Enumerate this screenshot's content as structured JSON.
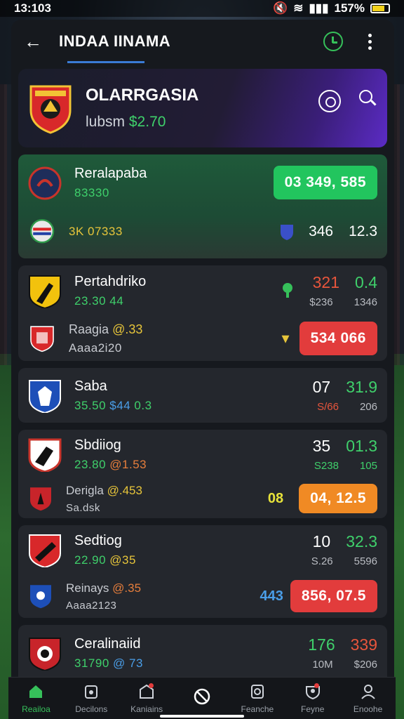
{
  "status_bar": {
    "time": "13:103",
    "battery": "157%"
  },
  "header": {
    "title": "INDAA IINAMA"
  },
  "hero": {
    "team": "OLARRGASIA",
    "label": "lubsm",
    "amount": "$2.70"
  },
  "colors": {
    "green": "#22c55e",
    "red": "#e23c3c",
    "orange": "#f08a24",
    "accent": "#36c05a"
  },
  "featured": {
    "team": "Reralapaba",
    "meta": "83330",
    "pill": "03  349, 585",
    "row2_meta": "3K 07333",
    "row2_nums": [
      "346",
      "12.3"
    ]
  },
  "matches": [
    {
      "team": "Pertahdriko",
      "meta": "23.30 44",
      "big": [
        "321",
        "0.4"
      ],
      "small": [
        "$236",
        "1346"
      ],
      "team2": "Raagia",
      "team2_meta": "@.33",
      "team2_sub": "Aaaa2i20",
      "pill": "534  066"
    },
    {
      "team": "Saba",
      "meta_a": "35.50",
      "meta_b": "$44",
      "meta_c": "0.3",
      "big": [
        "07",
        "31.9"
      ],
      "small": [
        "S/66",
        "206"
      ]
    },
    {
      "team": "Sbdiiog",
      "meta_a": "23.80",
      "meta_b": "@1.53",
      "big": [
        "35",
        "01.3"
      ],
      "small": [
        "S238",
        "105"
      ],
      "team2": "Derigla",
      "team2_meta": "@.453",
      "team2_sub": "Sa.dsk",
      "tag": "08",
      "pill": "04, 12.5"
    },
    {
      "team": "Sedtiog",
      "meta_a": "22.90",
      "meta_b": "@35",
      "big": [
        "10",
        "32.3"
      ],
      "small": [
        "S.26",
        "5596"
      ],
      "team2": "Reinays",
      "team2_meta": "@.35",
      "team2_sub": "Aaaa2123",
      "tag": "443",
      "pill": "856, 07.5"
    },
    {
      "team": "Ceralinaiid",
      "meta_a": "31790",
      "meta_b": "@ 73",
      "big": [
        "176",
        "339"
      ],
      "small": [
        "10M",
        "$206"
      ]
    }
  ],
  "bottom_nav": [
    {
      "label": "Reailoa",
      "icon": "home-icon"
    },
    {
      "label": "Decilons",
      "icon": "bag-icon"
    },
    {
      "label": "Kaniains",
      "icon": "stadium-icon"
    },
    {
      "label": "",
      "icon": "block-icon"
    },
    {
      "label": "Feanche",
      "icon": "clipboard-icon"
    },
    {
      "label": "Feyne",
      "icon": "shield-icon"
    },
    {
      "label": "Enoohe",
      "icon": "user-icon"
    }
  ]
}
